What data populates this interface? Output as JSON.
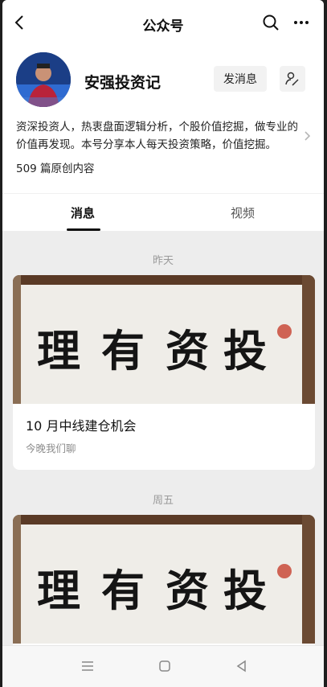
{
  "header": {
    "title": "公众号",
    "back_icon": "back-arrow-icon",
    "search_icon": "search-icon",
    "more_icon": "more-dots-icon"
  },
  "account": {
    "name": "安强投资记",
    "message_button": "发消息",
    "follow_icon": "user-settings-icon",
    "description": "资深投资人，热衷盘面逻辑分析，个股价值挖掘，做专业的价值再发现。本号分享本人每天投资策略，价值挖掘。",
    "article_count": "509 篇原创内容"
  },
  "tabs": [
    {
      "label": "消息",
      "active": true
    },
    {
      "label": "视频",
      "active": false
    }
  ],
  "feed": [
    {
      "date": "昨天",
      "title": "10 月中线建仓机会",
      "subtitle": "今晚我们聊",
      "image_text": [
        "理",
        "有",
        "资",
        "投"
      ]
    },
    {
      "date": "周五",
      "title": "",
      "subtitle": "",
      "image_text": [
        "理",
        "有",
        "资",
        "投"
      ]
    }
  ],
  "system_nav": {
    "menu_icon": "menu-icon",
    "home_icon": "home-square-icon",
    "back_icon": "back-triangle-icon"
  },
  "colors": {
    "background": "#ededed",
    "card": "#ffffff",
    "accent_text": "#111111",
    "muted_text": "#9a9a9a"
  }
}
